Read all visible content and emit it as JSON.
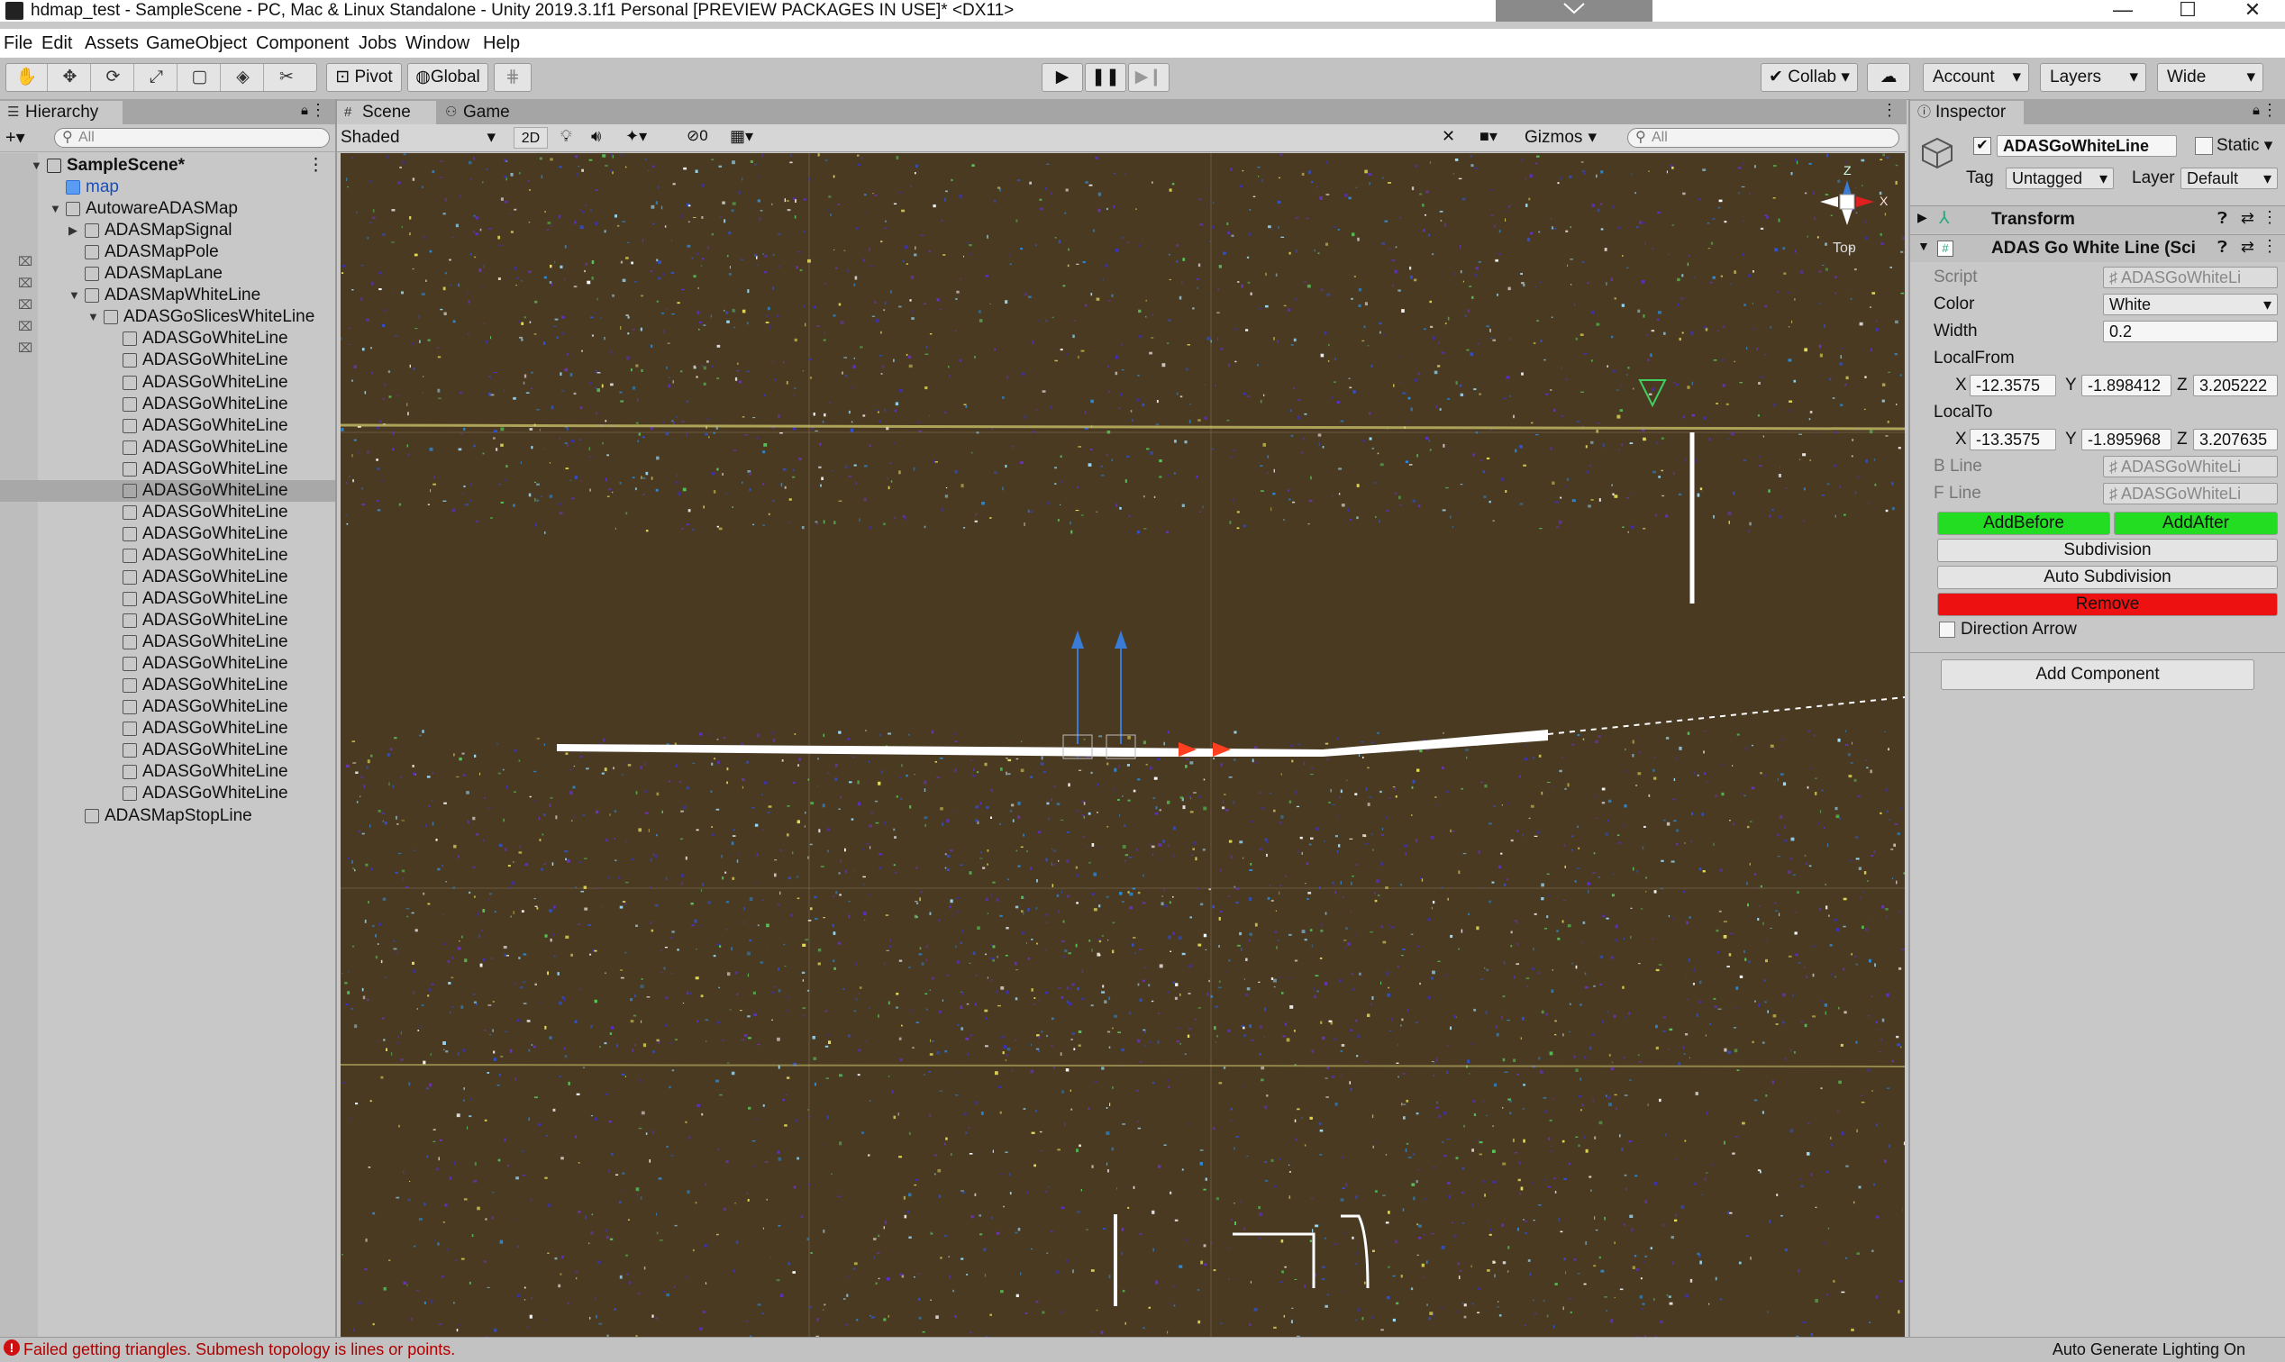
{
  "window": {
    "title": "hdmap_test - SampleScene - PC, Mac & Linux Standalone - Unity 2019.3.1f1 Personal [PREVIEW PACKAGES IN USE]* <DX11>",
    "controls": {
      "minimize": "—",
      "maximize": "☐",
      "close": "✕"
    }
  },
  "menu": [
    "File",
    "Edit",
    "Assets",
    "GameObject",
    "Component",
    "Jobs",
    "Window",
    "Help"
  ],
  "toolbar": {
    "tools": [
      "hand-tool",
      "move-tool",
      "rotate-tool",
      "scale-tool",
      "rect-tool",
      "transform-tool",
      "custom-tool"
    ],
    "pivot": "Pivot",
    "global": "Global",
    "collab": "Collab",
    "account": "Account",
    "layers": "Layers",
    "layout": "Wide"
  },
  "hierarchy": {
    "tab": "Hierarchy",
    "search_placeholder": "All",
    "rows": [
      {
        "label": "SampleScene*",
        "indent": 0,
        "arrow": "▼",
        "kind": "scene",
        "bold": true
      },
      {
        "label": "map",
        "indent": 1,
        "arrow": "",
        "kind": "prefab",
        "blue": true
      },
      {
        "label": "AutowareADASMap",
        "indent": 1,
        "arrow": "▼",
        "kind": "cube"
      },
      {
        "label": "ADASMapSignal",
        "indent": 2,
        "arrow": "▶",
        "kind": "cube"
      },
      {
        "label": "ADASMapPole",
        "indent": 2,
        "arrow": "",
        "kind": "cube"
      },
      {
        "label": "ADASMapLane",
        "indent": 2,
        "arrow": "",
        "kind": "cube"
      },
      {
        "label": "ADASMapWhiteLine",
        "indent": 2,
        "arrow": "▼",
        "kind": "cube"
      },
      {
        "label": "ADASGoSlicesWhiteLine",
        "indent": 3,
        "arrow": "▼",
        "kind": "cube"
      },
      {
        "label": "ADASGoWhiteLine",
        "indent": 4,
        "arrow": "",
        "kind": "cube"
      },
      {
        "label": "ADASGoWhiteLine",
        "indent": 4,
        "arrow": "",
        "kind": "cube"
      },
      {
        "label": "ADASGoWhiteLine",
        "indent": 4,
        "arrow": "",
        "kind": "cube"
      },
      {
        "label": "ADASGoWhiteLine",
        "indent": 4,
        "arrow": "",
        "kind": "cube"
      },
      {
        "label": "ADASGoWhiteLine",
        "indent": 4,
        "arrow": "",
        "kind": "cube"
      },
      {
        "label": "ADASGoWhiteLine",
        "indent": 4,
        "arrow": "",
        "kind": "cube"
      },
      {
        "label": "ADASGoWhiteLine",
        "indent": 4,
        "arrow": "",
        "kind": "cube"
      },
      {
        "label": "ADASGoWhiteLine",
        "indent": 4,
        "arrow": "",
        "kind": "cube",
        "selected": true
      },
      {
        "label": "ADASGoWhiteLine",
        "indent": 4,
        "arrow": "",
        "kind": "cube"
      },
      {
        "label": "ADASGoWhiteLine",
        "indent": 4,
        "arrow": "",
        "kind": "cube"
      },
      {
        "label": "ADASGoWhiteLine",
        "indent": 4,
        "arrow": "",
        "kind": "cube"
      },
      {
        "label": "ADASGoWhiteLine",
        "indent": 4,
        "arrow": "",
        "kind": "cube"
      },
      {
        "label": "ADASGoWhiteLine",
        "indent": 4,
        "arrow": "",
        "kind": "cube"
      },
      {
        "label": "ADASGoWhiteLine",
        "indent": 4,
        "arrow": "",
        "kind": "cube"
      },
      {
        "label": "ADASGoWhiteLine",
        "indent": 4,
        "arrow": "",
        "kind": "cube"
      },
      {
        "label": "ADASGoWhiteLine",
        "indent": 4,
        "arrow": "",
        "kind": "cube"
      },
      {
        "label": "ADASGoWhiteLine",
        "indent": 4,
        "arrow": "",
        "kind": "cube"
      },
      {
        "label": "ADASGoWhiteLine",
        "indent": 4,
        "arrow": "",
        "kind": "cube"
      },
      {
        "label": "ADASGoWhiteLine",
        "indent": 4,
        "arrow": "",
        "kind": "cube"
      },
      {
        "label": "ADASGoWhiteLine",
        "indent": 4,
        "arrow": "",
        "kind": "cube"
      },
      {
        "label": "ADASGoWhiteLine",
        "indent": 4,
        "arrow": "",
        "kind": "cube"
      },
      {
        "label": "ADASGoWhiteLine",
        "indent": 4,
        "arrow": "",
        "kind": "cube"
      },
      {
        "label": "ADASMapStopLine",
        "indent": 2,
        "arrow": "",
        "kind": "cube"
      }
    ]
  },
  "scene": {
    "tabs": [
      "Scene",
      "Game"
    ],
    "shading": "Shaded",
    "mode_2d": "2D",
    "hidden_count": "0",
    "gizmos": "Gizmos",
    "search_placeholder": "All",
    "gizmo_labels": {
      "y": "Z",
      "x": "X",
      "view": "Top"
    },
    "colors": {
      "background": "#4a3a22",
      "line": "#ffffff",
      "handle": "#3a7bd5",
      "arrow": "#ff4020"
    }
  },
  "inspector": {
    "tab": "Inspector",
    "object_name": "ADASGoWhiteLine",
    "static_label": "Static",
    "tag_label": "Tag",
    "tag_value": "Untagged",
    "layer_label": "Layer",
    "layer_value": "Default",
    "transform_label": "Transform",
    "component_label": "ADAS Go White Line (Sci",
    "fields": {
      "script_label": "Script",
      "script_value": "ADASGoWhiteLi",
      "color_label": "Color",
      "color_value": "White",
      "width_label": "Width",
      "width_value": "0.2",
      "localfrom_label": "LocalFrom",
      "localfrom": {
        "x": "-12.3575",
        "y": "-1.898412",
        "z": "3.205222"
      },
      "localto_label": "LocalTo",
      "localto": {
        "x": "-13.3575",
        "y": "-1.895968",
        "z": "3.207635"
      },
      "bline_label": "B Line",
      "bline_value": "ADASGoWhiteLi",
      "fline_label": "F Line",
      "fline_value": "ADASGoWhiteLi",
      "axis_x": "X",
      "axis_y": "Y",
      "axis_z": "Z"
    },
    "buttons": {
      "add_before": "AddBefore",
      "add_after": "AddAfter",
      "subdivision": "Subdivision",
      "auto_subdivision": "Auto Subdivision",
      "remove": "Remove"
    },
    "direction_arrow_label": "Direction Arrow",
    "add_component": "Add Component",
    "colors": {
      "green": "#22dd22",
      "red": "#ee1111"
    }
  },
  "status": {
    "error_message": "Failed getting triangles. Submesh topology is lines or points.",
    "right_text": "Auto Generate Lighting On"
  }
}
